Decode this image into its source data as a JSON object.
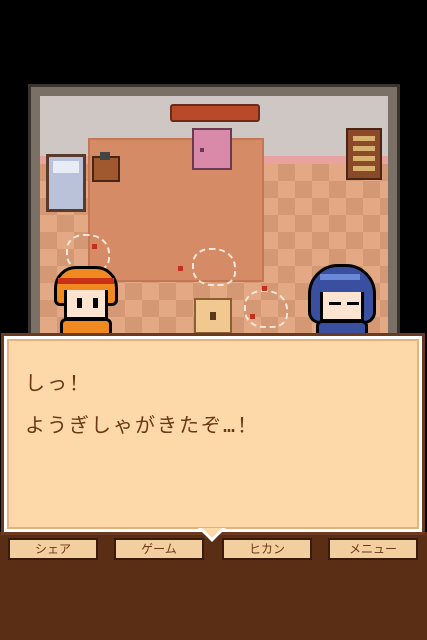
{
  "dialog": {
    "line1": "しっ！",
    "line2": "ようぎしゃがきたぞ…！"
  },
  "menu": {
    "btn1": "シェア",
    "btn2": "ゲーム",
    "btn3": "ヒカン",
    "btn4": "メニュー"
  },
  "colors": {
    "dialog_bg": "#fdd8a8",
    "text": "#6a3816",
    "floor": "#e3a984"
  }
}
